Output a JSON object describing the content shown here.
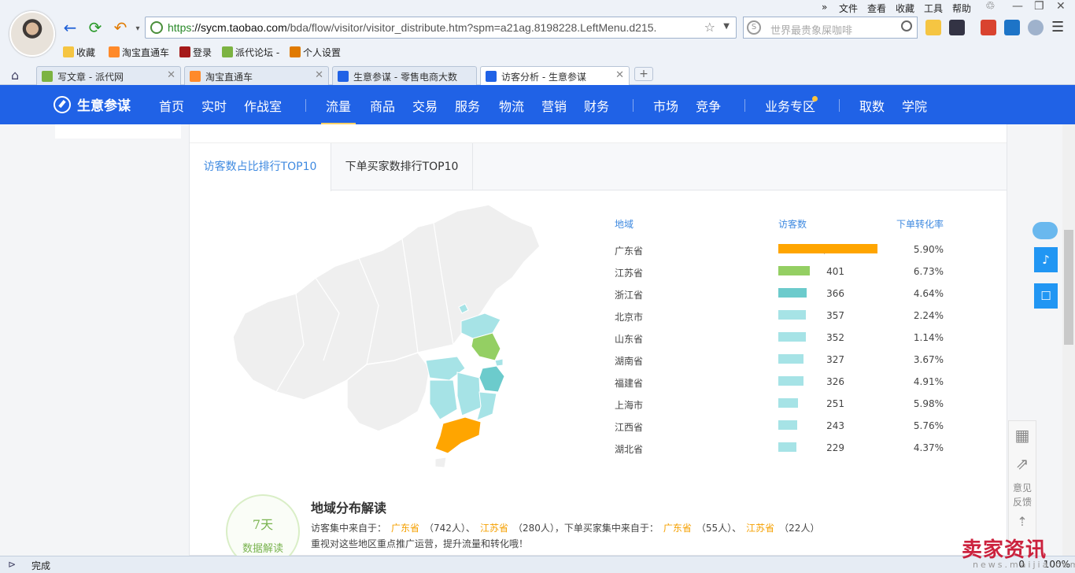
{
  "browser": {
    "menu": [
      "文件",
      "查看",
      "收藏",
      "工具",
      "帮助"
    ],
    "address": {
      "scheme": "https",
      "host": "://sycm.taobao.com",
      "path": "/bda/flow/visitor/visitor_distribute.htm?spm=a21ag.8198228.LeftMenu.d215."
    },
    "search_placeholder": "世界最贵象屎咖啡",
    "bookmarks": [
      "收藏",
      "淘宝直通车",
      "登录",
      "派代论坛 -",
      "个人设置"
    ],
    "tabs": [
      {
        "label": "写文章 - 派代网"
      },
      {
        "label": "淘宝直通车"
      },
      {
        "label": "生意参谋 - 零售电商大数"
      },
      {
        "label": "访客分析 - 生意参谋"
      }
    ],
    "status_text": "完成",
    "zoom": "100%",
    "counter": "0"
  },
  "app": {
    "brand": "生意参谋",
    "nav": [
      "首页",
      "实时",
      "作战室",
      "流量",
      "商品",
      "交易",
      "服务",
      "物流",
      "营销",
      "财务",
      "市场",
      "竞争",
      "业务专区",
      "取数",
      "学院"
    ],
    "active_nav": "流量",
    "colors": {
      "primary": "#2062e6",
      "accent": "#3f8ae0",
      "highlight": "#f5a000"
    }
  },
  "content": {
    "tabs": [
      "访客数占比排行TOP10",
      "下单买家数排行TOP10"
    ],
    "active_tab": 0,
    "table": {
      "headers": {
        "region": "地域",
        "visitors": "访客数",
        "conversion": "下单转化率"
      },
      "max_visitors": 1272,
      "rows": [
        {
          "province": "广东省",
          "visitors": "1,272",
          "value": 1272,
          "rate": "5.90%",
          "color": "#ffa500"
        },
        {
          "province": "江苏省",
          "visitors": "401",
          "value": 401,
          "rate": "6.73%",
          "color": "#94cf63"
        },
        {
          "province": "浙江省",
          "visitors": "366",
          "value": 366,
          "rate": "4.64%",
          "color": "#6ccbcc"
        },
        {
          "province": "北京市",
          "visitors": "357",
          "value": 357,
          "rate": "2.24%",
          "color": "#a6e3e6"
        },
        {
          "province": "山东省",
          "visitors": "352",
          "value": 352,
          "rate": "1.14%",
          "color": "#a6e3e6"
        },
        {
          "province": "湖南省",
          "visitors": "327",
          "value": 327,
          "rate": "3.67%",
          "color": "#a6e3e6"
        },
        {
          "province": "福建省",
          "visitors": "326",
          "value": 326,
          "rate": "4.91%",
          "color": "#a6e3e6"
        },
        {
          "province": "上海市",
          "visitors": "251",
          "value": 251,
          "rate": "5.98%",
          "color": "#a6e3e6"
        },
        {
          "province": "江西省",
          "visitors": "243",
          "value": 243,
          "rate": "5.76%",
          "color": "#a6e3e6"
        },
        {
          "province": "湖北省",
          "visitors": "229",
          "value": 229,
          "rate": "4.37%",
          "color": "#a6e3e6"
        }
      ]
    },
    "interpretation": {
      "days": "7",
      "days_unit": "天",
      "badge_label": "数据解读",
      "title": "地域分布解读",
      "line1_prefix": "访客集中来自于：",
      "v1": "广东省",
      "v1_count": "（742人）、",
      "v2": "江苏省",
      "v2_count": "（280人），下单买家集中来自于：",
      "b1": "广东省",
      "b1_count": "（55人）、",
      "b2": "江苏省",
      "b2_count": "（22人）",
      "line2": "重视对这些地区重点推广运营，提升流量和转化哦！"
    }
  },
  "side": {
    "feedback_label": "意见反馈"
  },
  "watermark": {
    "text": "卖家资讯",
    "sub": "news.maijia.com"
  }
}
